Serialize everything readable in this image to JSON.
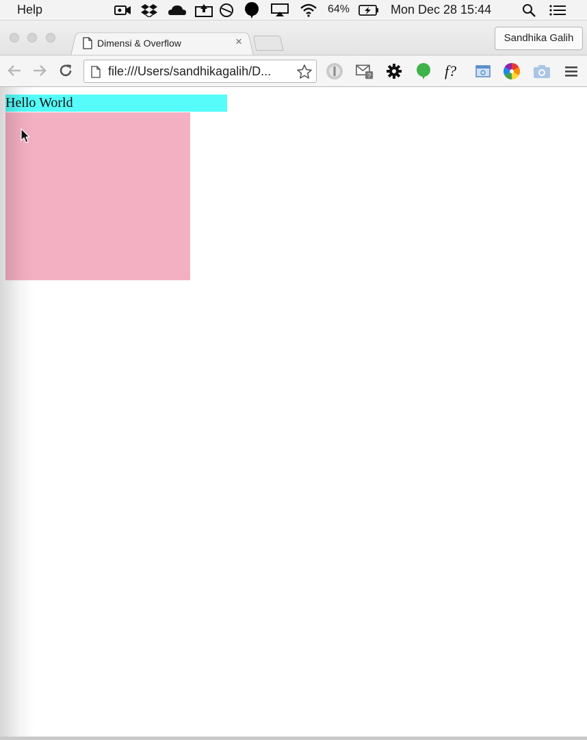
{
  "menubar": {
    "app_menu": "Help",
    "battery_percent": "64%",
    "clock": "Mon Dec 28  15:44"
  },
  "browser": {
    "tab": {
      "title": "Dimensi & Overflow",
      "close_glyph": "×"
    },
    "profile_button": "Sandhika Galih",
    "address_bar": {
      "url": "file:///Users/sandhikagalih/D..."
    },
    "extensions": [
      {
        "name": "shield-extension-icon"
      },
      {
        "name": "gmail-checker-icon",
        "badge": "?"
      },
      {
        "name": "gear-extension-icon"
      },
      {
        "name": "green-balloon-icon"
      },
      {
        "name": "whatfont-icon",
        "label": "f?"
      },
      {
        "name": "window-extension-icon"
      },
      {
        "name": "color-wheel-icon"
      },
      {
        "name": "screenshot-camera-icon"
      }
    ]
  },
  "page": {
    "hello_text": "Hello World",
    "colors": {
      "hello_background": "#55fcf9",
      "box_background": "#f4b0c3"
    }
  }
}
